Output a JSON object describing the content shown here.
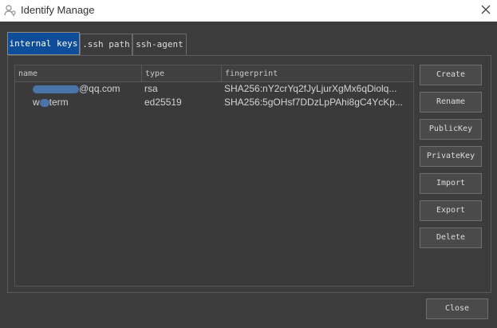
{
  "window": {
    "title": "Identify Manage",
    "title_icon": "key-person-icon",
    "close_icon": "close-icon"
  },
  "tabs": [
    {
      "label": "internal keys",
      "active": true
    },
    {
      "label": ".ssh path",
      "active": false
    },
    {
      "label": "ssh-agent",
      "active": false
    }
  ],
  "table": {
    "columns": [
      "name",
      "type",
      "fingerprint"
    ],
    "rows": [
      {
        "name_suffix": "@qq.com",
        "type": "rsa",
        "fingerprint": "SHA256:nY2crYq2fJyLjurXgMx6qDiolq..."
      },
      {
        "name_prefix": "w",
        "name_suffix": "term",
        "type": "ed25519",
        "fingerprint": "SHA256:5gOHsf7DDzLpPAhi8gC4YcKp..."
      }
    ]
  },
  "buttons": {
    "create": "Create",
    "rename": "Rename",
    "public_key": "PublicKey",
    "private_key": "PrivateKey",
    "import": "Import",
    "export": "Export",
    "delete": "Delete",
    "close": "Close"
  },
  "colors": {
    "active_tab": "#0d4d9a",
    "background": "#3c3c3c",
    "redaction_blur": "#4f7fbf"
  }
}
